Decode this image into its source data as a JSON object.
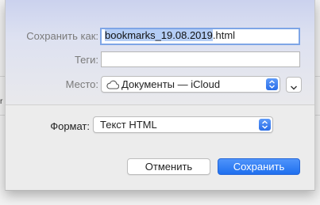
{
  "dialog": {
    "save_as_label": "Сохранить как:",
    "filename_selected": "bookmarks_19.08.2019",
    "filename_ext": ".html",
    "tags_label": "Теги:",
    "tags_value": "",
    "location_label": "Место:",
    "location_value": "Документы — iCloud",
    "location_icon": "cloud-icon",
    "format_label": "Формат:",
    "format_value": "Текст HTML",
    "cancel_label": "Отменить",
    "save_label": "Сохранить"
  },
  "colors": {
    "accent": "#2a6ee8",
    "selection": "#b4cdf5",
    "sheet_header": "#cbd2ee"
  }
}
